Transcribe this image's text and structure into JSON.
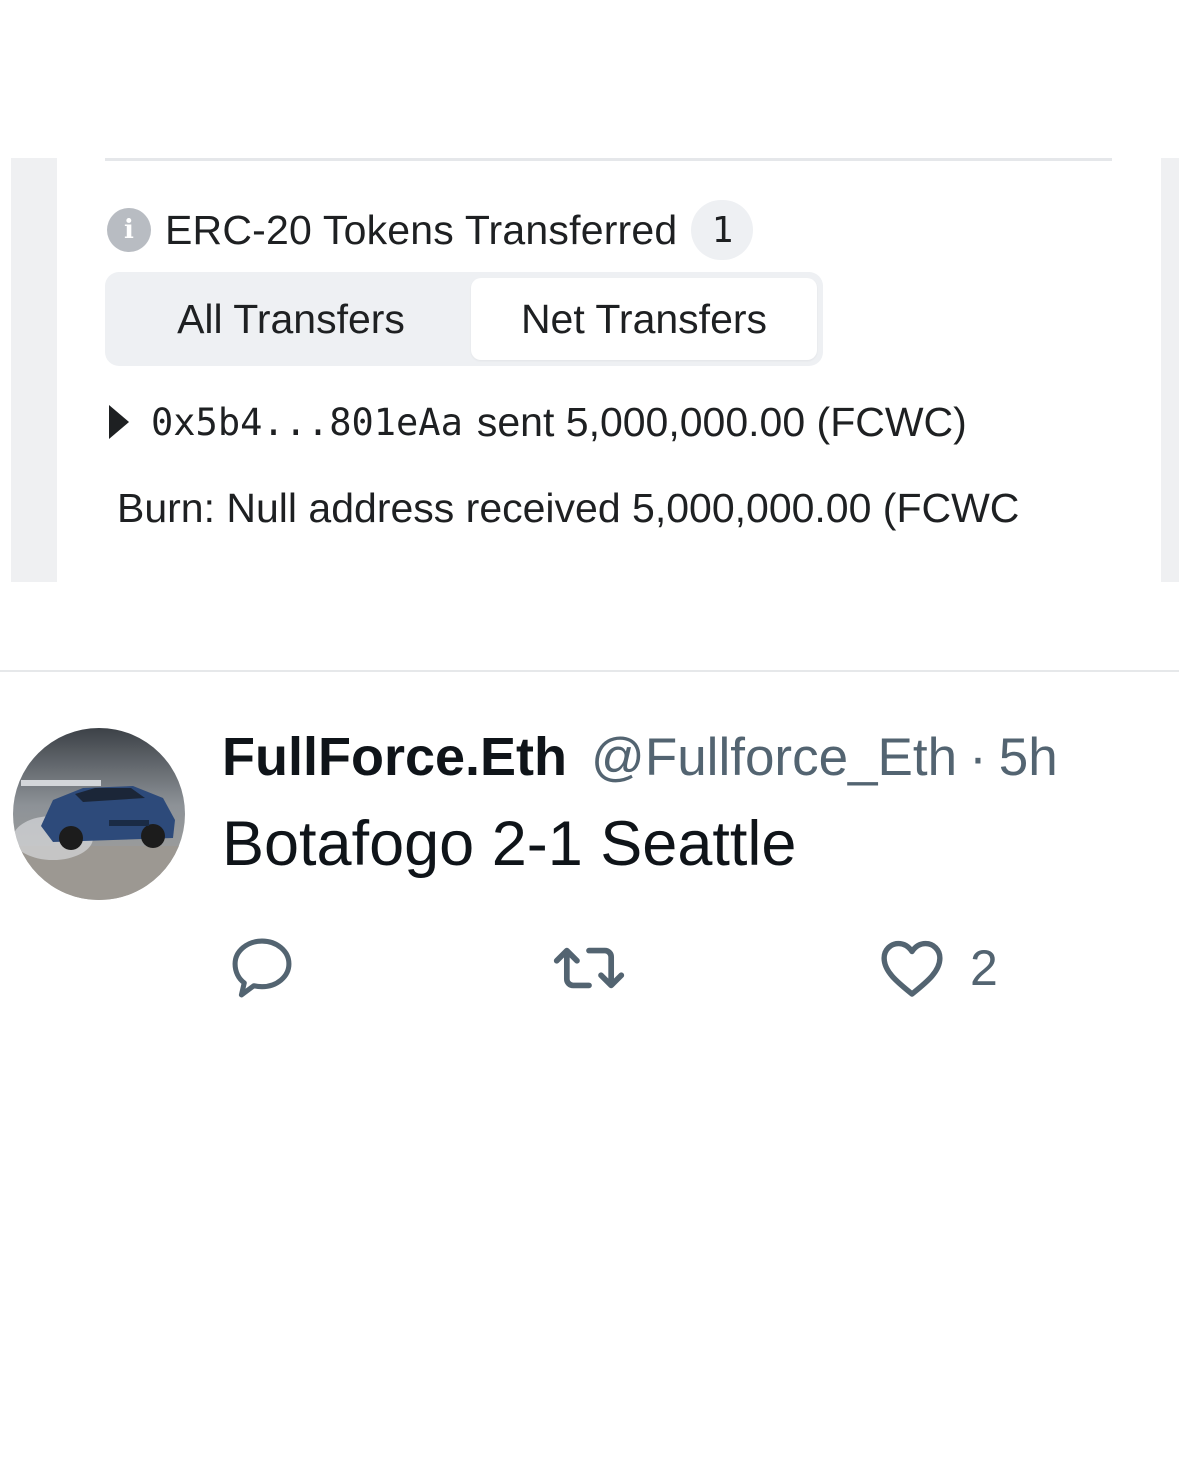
{
  "token_card": {
    "info_icon_glyph": "i",
    "heading": "ERC-20 Tokens Transferred",
    "count": "1",
    "tabs": [
      {
        "label": "All Transfers",
        "active": false
      },
      {
        "label": "Net Transfers",
        "active": true
      }
    ],
    "transfer": {
      "address": "0x5b4...801eAa",
      "text": "sent 5,000,000.00 (FCWC)"
    },
    "burn_text": "Burn: Null address received 5,000,000.00 (FCWC"
  },
  "tweet": {
    "display_name": "FullForce.Eth",
    "handle": "@Fullforce_Eth",
    "separator": "·",
    "time": "5h",
    "text": "Botafogo 2-1 Seattle",
    "actions": {
      "reply_icon": "reply-icon",
      "retweet_icon": "retweet-icon",
      "like_icon": "heart-icon",
      "like_count": "2"
    }
  },
  "colors": {
    "text_primary": "#0f1419",
    "text_secondary": "#536471",
    "etherscan_text": "#1e2022",
    "panel_gray": "#eef0f3"
  }
}
